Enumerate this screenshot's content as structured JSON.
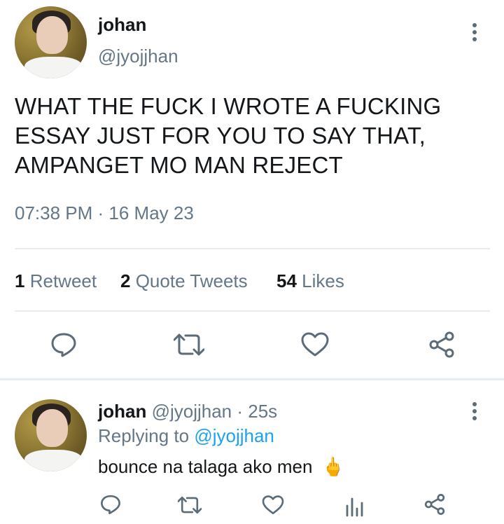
{
  "tweet": {
    "author_name": "johan",
    "author_handle": "@jyojjhan",
    "text": "WHAT THE FUCK I WROTE A FUCKING ESSAY JUST FOR YOU TO SAY THAT, AMPANGET MO MAN REJECT",
    "text_lines": [
      "WHAT THE FUCK I WROTE A FUCKING",
      "ESSAY JUST FOR YOU TO SAY THAT,",
      "AMPANGET MO MAN REJECT"
    ],
    "timestamp": "07:38 PM · 16 May 23",
    "stats": {
      "retweets_count": "1",
      "retweets_label": "Retweet",
      "quotes_count": "2",
      "quotes_label": "Quote Tweets",
      "likes_count": "54",
      "likes_label": "Likes"
    },
    "actions": [
      "reply-icon",
      "retweet-icon",
      "like-icon",
      "share-icon"
    ]
  },
  "reply": {
    "author_name": "johan",
    "author_handle": "@jyojjhan",
    "time": "· 25s",
    "replying_prefix": "Replying to",
    "replying_handle": "@jyojjhan",
    "text": "bounce na talaga ako men",
    "emoji": "🖕",
    "actions": [
      "reply-icon",
      "retweet-icon",
      "like-icon",
      "analytics-icon",
      "share-icon"
    ]
  },
  "colors": {
    "text": "#14171a",
    "muted": "#657786",
    "link": "#1da1f2",
    "divider": "#e6ecf0",
    "icon": "#5b6b78"
  }
}
